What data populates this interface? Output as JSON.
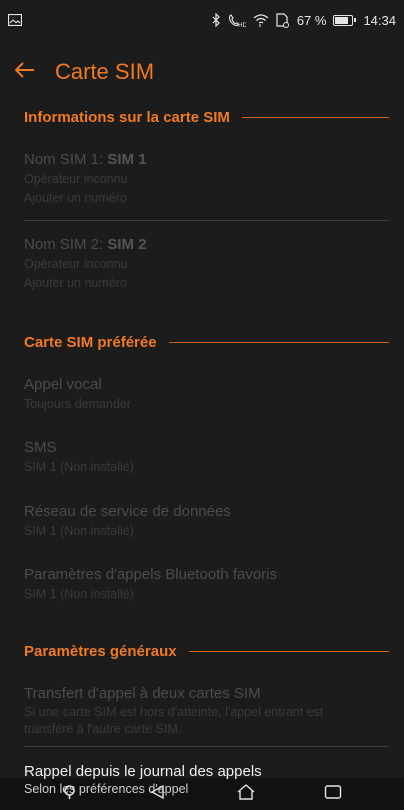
{
  "status_bar": {
    "battery_percent": "67 %",
    "battery_level": 0.67,
    "time": "14:34",
    "icons": [
      "image-icon",
      "bluetooth-icon",
      "hd-call-icon",
      "wifi-icon",
      "sim-icon",
      "battery-icon"
    ]
  },
  "app_bar": {
    "title": "Carte SIM",
    "back_icon": "arrow-left-icon"
  },
  "sections": {
    "sim_info": "Informations sur la carte SIM",
    "preferred_sim": "Carte SIM préférée",
    "general": "Paramètres généraux"
  },
  "sim1": {
    "label": "Nom SIM 1: ",
    "name": "SIM 1",
    "operator": "Opérateur inconnu",
    "add_number": "Ajouter un numéro"
  },
  "sim2": {
    "label": "Nom SIM 2: ",
    "name": "SIM 2",
    "operator": "Opérateur inconnu",
    "add_number": "Ajouter un numéro"
  },
  "preferred": {
    "voice_call": {
      "title": "Appel vocal",
      "value": "Toujours demander"
    },
    "sms": {
      "title": "SMS",
      "value": "SIM 1 (Non installé)"
    },
    "data_network": {
      "title": "Réseau de service de données",
      "value": "SIM 1 (Non installé)"
    },
    "bluetooth_call": {
      "title": "Paramètres d'appels Bluetooth favoris",
      "value": "SIM 1 (Non installé)"
    }
  },
  "general": {
    "dual_forward": {
      "title": "Transfert d'appel à deux cartes SIM",
      "desc_line1": "Si une carte SIM est hors d'atteinte, l'appel entrant est",
      "desc_line2": "transféré à l'autre carte SIM."
    },
    "callback": {
      "title": "Rappel depuis le journal des appels",
      "desc": "Selon les préférences d'appel"
    }
  },
  "nav_bar": {
    "icons": [
      "search-icon",
      "back-triangle-icon",
      "home-icon",
      "recents-icon"
    ]
  }
}
